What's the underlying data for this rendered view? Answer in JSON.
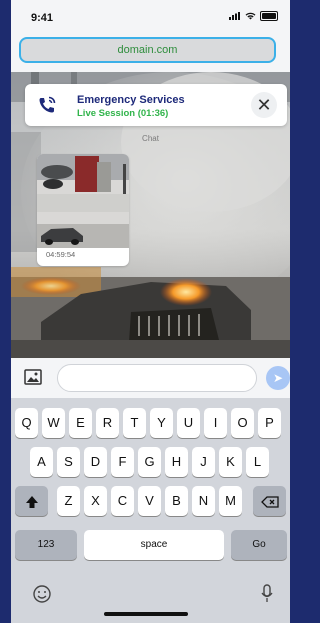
{
  "status_bar": {
    "time": "9:41"
  },
  "browser": {
    "url": "domain.com"
  },
  "call_card": {
    "title": "Emergency Services",
    "subtitle": "Live Session (01:36)",
    "close_icon": "close-icon",
    "phone_icon": "phone-ringing-icon"
  },
  "chat": {
    "label": "Chat",
    "messages": [
      {
        "type": "image",
        "timestamp": "04:59:54"
      }
    ]
  },
  "composer": {
    "image_icon": "image-icon",
    "placeholder": "",
    "send_icon": "send-icon"
  },
  "keyboard": {
    "row1": [
      "Q",
      "W",
      "E",
      "R",
      "T",
      "Y",
      "U",
      "I",
      "O",
      "P"
    ],
    "row2": [
      "A",
      "S",
      "D",
      "F",
      "G",
      "H",
      "J",
      "K",
      "L"
    ],
    "row3": [
      "Z",
      "X",
      "C",
      "V",
      "B",
      "N",
      "M"
    ],
    "numbers_label": "123",
    "space_label": "space",
    "go_label": "Go",
    "shift_icon": "shift-icon",
    "backspace_icon": "backspace-icon",
    "emoji_icon": "emoji-icon",
    "mic_icon": "mic-icon"
  },
  "colors": {
    "accent_blue": "#3bb0e8",
    "title_navy": "#1e2a7a",
    "live_green": "#31b44b",
    "frame": "#1d2b6e"
  }
}
